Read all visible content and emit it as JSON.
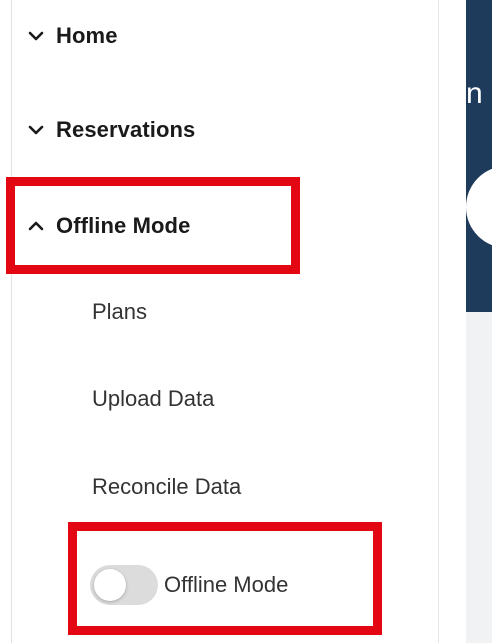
{
  "sidebar": {
    "items": [
      {
        "label": "Home",
        "expanded": false
      },
      {
        "label": "Reservations",
        "expanded": false
      },
      {
        "label": "Offline Mode",
        "expanded": true
      }
    ],
    "offline_submenu": [
      {
        "label": "Plans"
      },
      {
        "label": "Upload Data"
      },
      {
        "label": "Reconcile Data"
      }
    ],
    "offline_toggle": {
      "label": "Offline Mode",
      "on": false
    }
  },
  "main": {
    "header_title_fragment": "n"
  },
  "colors": {
    "highlight": "#e30613",
    "header_bg": "#1f3b5c",
    "toggle_off": "#dcdcdc"
  }
}
